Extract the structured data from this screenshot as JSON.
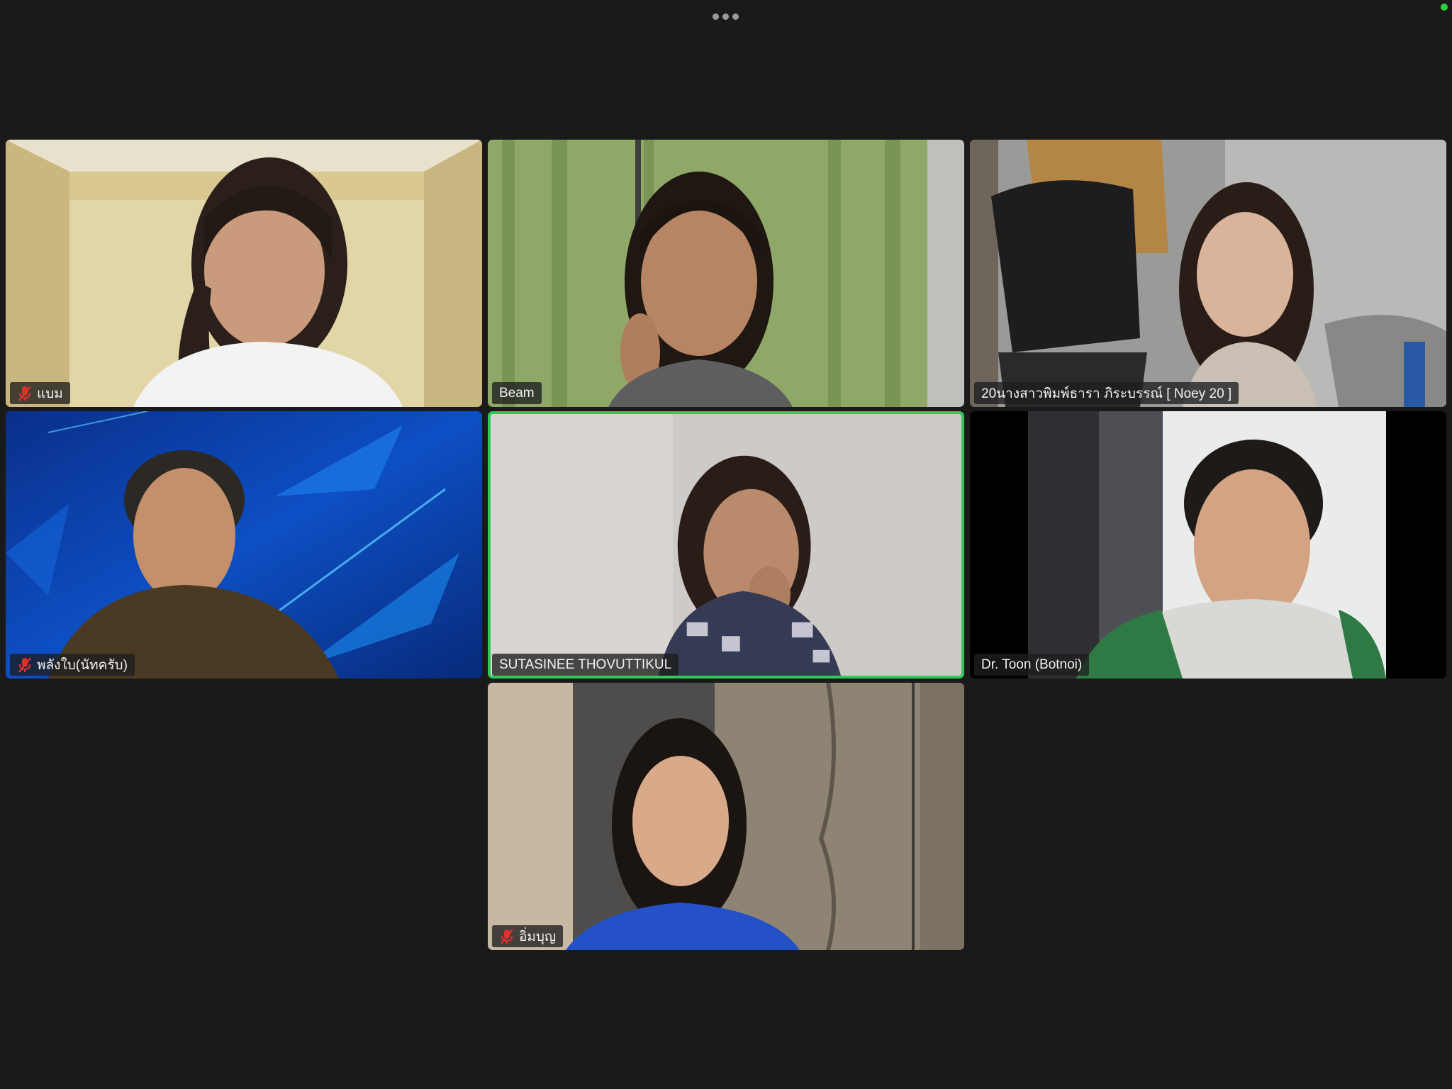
{
  "toolbar": {
    "more_icon": "ellipsis-horizontal-icon"
  },
  "status": {
    "color": "#2ecc40"
  },
  "participants": [
    {
      "name": "แบม",
      "muted": true
    },
    {
      "name": "Beam",
      "muted": false
    },
    {
      "name": "20นางสาวพิมพ์ธารา ภิระบรรณ์ [ Noey 20 ]",
      "muted": false
    },
    {
      "name": "พลังใบ(นัทครับ)",
      "muted": true
    },
    {
      "name": "SUTASINEE THOVUTTIKUL",
      "muted": false,
      "active_speaker": true
    },
    {
      "name": "Dr. Toon (Botnoi)",
      "muted": false
    },
    {
      "name": "อิ่มบุญ",
      "muted": true
    }
  ],
  "colors": {
    "background": "#1a1a1a",
    "active_speaker_border": "#34c759",
    "muted_icon": "#e0302e"
  }
}
